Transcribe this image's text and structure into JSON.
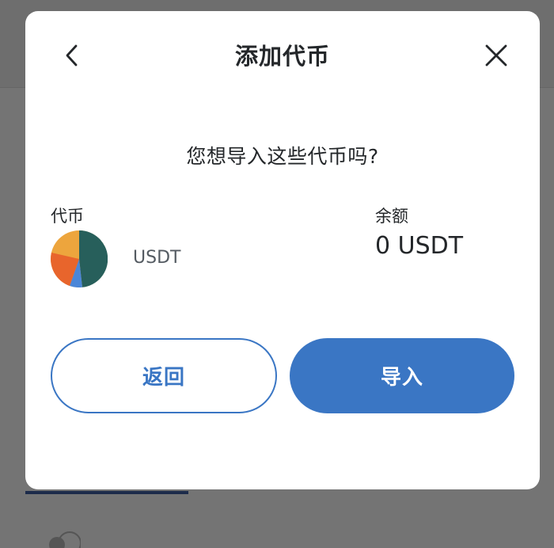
{
  "modal": {
    "title": "添加代币",
    "question": "您想导入这些代币吗?"
  },
  "table": {
    "token_header": "代币",
    "balance_header": "余额"
  },
  "token": {
    "symbol": "USDT",
    "balance": "0 USDT",
    "icon": "token-pie-icon",
    "icon_colors": [
      "#275f5b",
      "#eda53d",
      "#e8652c",
      "#4a86d8"
    ]
  },
  "buttons": {
    "cancel_label": "返回",
    "import_label": "导入"
  },
  "colors": {
    "accent": "#3a76c4",
    "text": "#24272a",
    "overlay": "#747474"
  },
  "icons": {
    "back": "chevron-left-icon",
    "close": "close-icon"
  }
}
